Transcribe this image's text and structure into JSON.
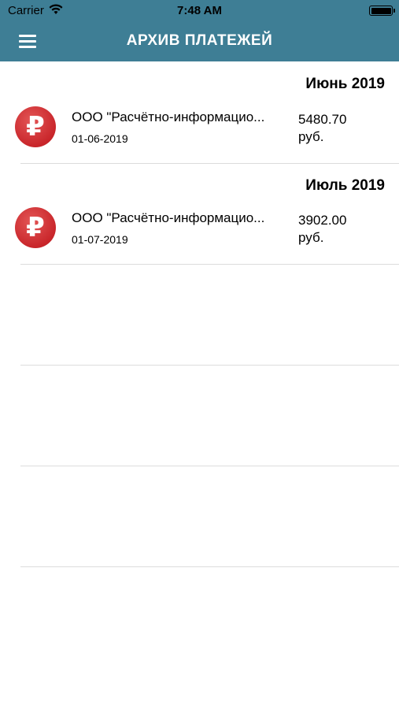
{
  "status_bar": {
    "carrier": "Carrier",
    "time": "7:48 AM"
  },
  "header": {
    "title": "АРХИВ ПЛАТЕЖЕЙ"
  },
  "sections": [
    {
      "header": "Июнь 2019",
      "payment": {
        "payee": "ООО \"Расчётно-информацио...",
        "date": "01-06-2019",
        "amount": "5480.70",
        "currency": "руб."
      }
    },
    {
      "header": "Июль 2019",
      "payment": {
        "payee": "ООО \"Расчётно-информацио...",
        "date": "01-07-2019",
        "amount": "3902.00",
        "currency": "руб."
      }
    }
  ],
  "icon_symbol": "₽",
  "colors": {
    "nav_background": "#3e7e95",
    "icon_red": "#c9262b"
  }
}
